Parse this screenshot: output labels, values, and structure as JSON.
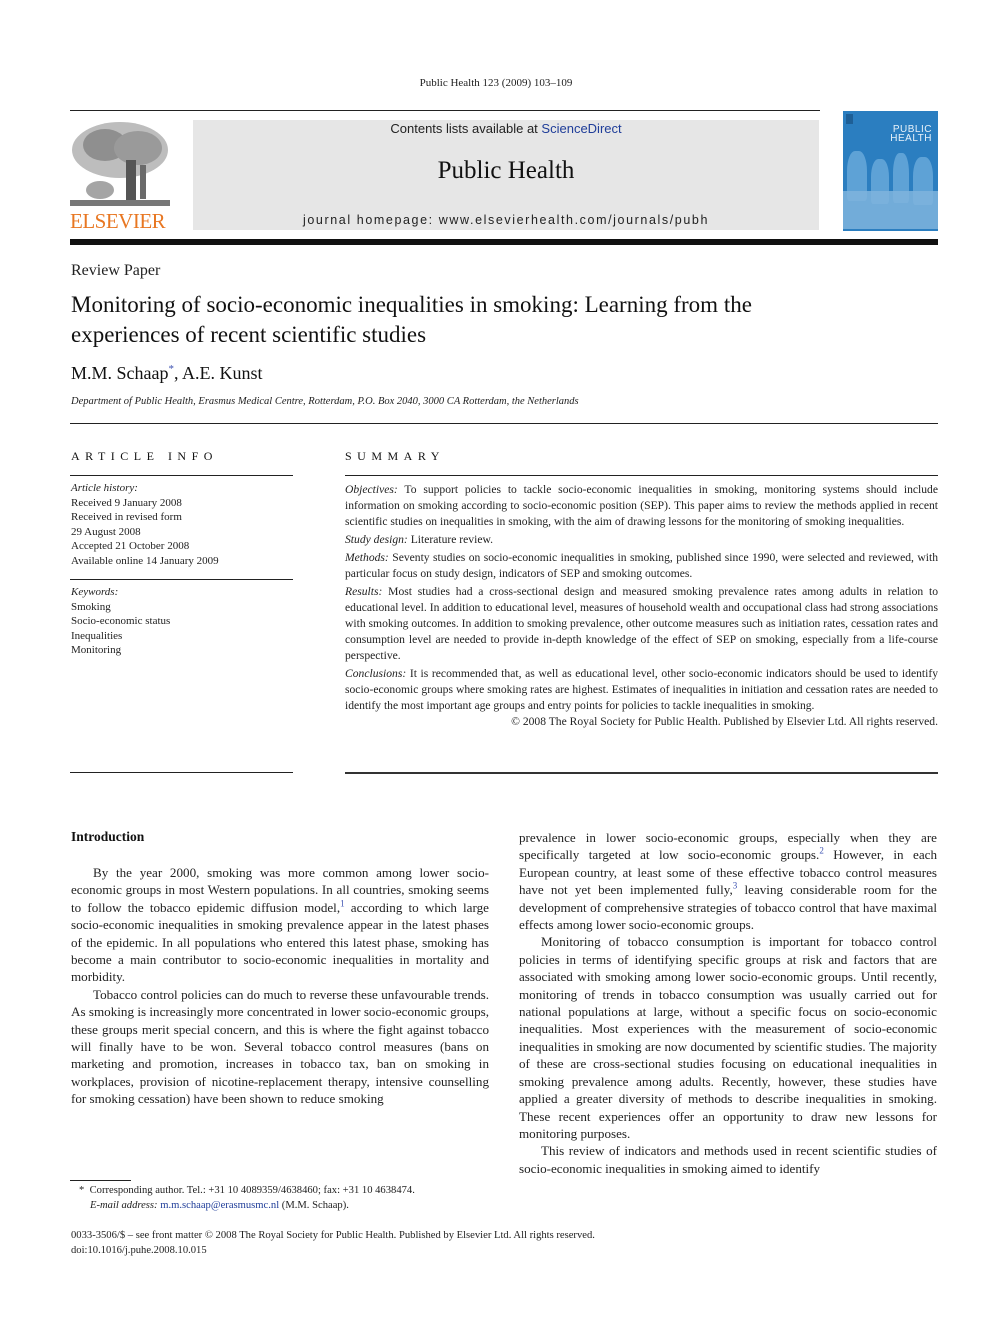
{
  "header": {
    "journal_reference": "Public Health 123 (2009) 103–109",
    "contents_prefix": "Contents lists available at",
    "contents_link": "ScienceDirect",
    "journal_title": "Public Health",
    "homepage": "journal homepage: www.elsevierhealth.com/journals/pubh",
    "publisher_logo": "ELSEVIER",
    "cover_title_line1": "PUBLIC",
    "cover_title_line2": "HEALTH",
    "colors": {
      "elsevier_orange": "#e87722",
      "link_blue": "#1f3d99",
      "masthead_gray": "#e6e6e6",
      "cover_blue": "#2b7ec0"
    }
  },
  "article": {
    "type": "Review Paper",
    "title": "Monitoring of socio-economic inequalities in smoking: Learning from the experiences of recent scientific studies",
    "author1": "M.M. Schaap",
    "author1_marker": "*",
    "author_separator": ", ",
    "author2": "A.E. Kunst",
    "affiliation": "Department of Public Health, Erasmus Medical Centre, Rotterdam, P.O. Box 2040, 3000 CA Rotterdam, the Netherlands"
  },
  "article_info": {
    "label": "ARTICLE INFO",
    "history_heading": "Article history:",
    "history": [
      "Received 9 January 2008",
      "Received in revised form",
      "29 August 2008",
      "Accepted 21 October 2008",
      "Available online 14 January 2009"
    ],
    "keywords_heading": "Keywords:",
    "keywords": [
      "Smoking",
      "Socio-economic status",
      "Inequalities",
      "Monitoring"
    ]
  },
  "summary": {
    "label": "SUMMARY",
    "sections": [
      {
        "lead": "Objectives:",
        "text": " To support policies to tackle socio-economic inequalities in smoking, monitoring systems should include information on smoking according to socio-economic position (SEP). This paper aims to review the methods applied in recent scientific studies on inequalities in smoking, with the aim of drawing lessons for the monitoring of smoking inequalities."
      },
      {
        "lead": "Study design:",
        "text": " Literature review."
      },
      {
        "lead": "Methods:",
        "text": " Seventy studies on socio-economic inequalities in smoking, published since 1990, were selected and reviewed, with particular focus on study design, indicators of SEP and smoking outcomes."
      },
      {
        "lead": "Results:",
        "text": " Most studies had a cross-sectional design and measured smoking prevalence rates among adults in relation to educational level. In addition to educational level, measures of household wealth and occupational class had strong associations with smoking outcomes. In addition to smoking prevalence, other outcome measures such as initiation rates, cessation rates and consumption level are needed to provide in-depth knowledge of the effect of SEP on smoking, especially from a life-course perspective."
      },
      {
        "lead": "Conclusions:",
        "text": " It is recommended that, as well as educational level, other socio-economic indicators should be used to identify socio-economic groups where smoking rates are highest. Estimates of inequalities in initiation and cessation rates are needed to identify the most important age groups and entry points for policies to tackle inequalities in smoking."
      }
    ],
    "copyright": "© 2008 The Royal Society for Public Health. Published by Elsevier Ltd. All rights reserved."
  },
  "body": {
    "intro_heading": "Introduction",
    "p1_a": "By the year 2000, smoking was more common among lower socio-economic groups in most Western populations. In all countries, smoking seems to follow the tobacco epidemic diffusion model,",
    "p1_ref": "1",
    "p1_b": " according to which large socio-economic inequalities in smoking prevalence appear in the latest phases of the epidemic. In all populations who entered this latest phase, smoking has become a main contributor to socio-economic inequalities in mortality and morbidity.",
    "p2": "Tobacco control policies can do much to reverse these unfavourable trends. As smoking is increasingly more concentrated in lower socio-economic groups, these groups merit special concern, and this is where the fight against tobacco will finally have to be won. Several tobacco control measures (bans on marketing and promotion, increases in tobacco tax, ban on smoking in workplaces, provision of nicotine-replacement therapy, intensive counselling for smoking cessation) have been shown to reduce smoking",
    "p2_cont_a": "prevalence in lower socio-economic groups, especially when they are specifically targeted at low socio-economic groups.",
    "p2_ref2": "2",
    "p2_cont_b": " However, in each European country, at least some of these effective tobacco control measures have not yet been implemented fully,",
    "p2_ref3": "3",
    "p2_cont_c": " leaving considerable room for the development of comprehensive strategies of tobacco control that have maximal effects among lower socio-economic groups.",
    "p3": "Monitoring of tobacco consumption is important for tobacco control policies in terms of identifying specific groups at risk and factors that are associated with smoking among lower socio-economic groups. Until recently, monitoring of trends in tobacco consumption was usually carried out for national populations at large, without a specific focus on socio-economic inequalities. Most experiences with the measurement of socio-economic inequalities in smoking are now documented by scientific studies. The majority of these are cross-sectional studies focusing on educational inequalities in smoking prevalence among adults. Recently, however, these studies have applied a greater diversity of methods to describe inequalities in smoking. These recent experiences offer an opportunity to draw new lessons for monitoring purposes.",
    "p4": "This review of indicators and methods used in recent scientific studies of socio-economic inequalities in smoking aimed to identify"
  },
  "footnote": {
    "marker": "*",
    "corresponding": "Corresponding author. Tel.: +31 10 4089359/4638460; fax: +31 10 4638474.",
    "email_label": "E-mail address:",
    "email": "m.m.schaap@erasmusmc.nl",
    "email_suffix": " (M.M. Schaap)."
  },
  "front_matter": {
    "issn_line": "0033-3506/$ – see front matter © 2008 The Royal Society for Public Health. Published by Elsevier Ltd. All rights reserved.",
    "doi": "doi:10.1016/j.puhe.2008.10.015"
  }
}
